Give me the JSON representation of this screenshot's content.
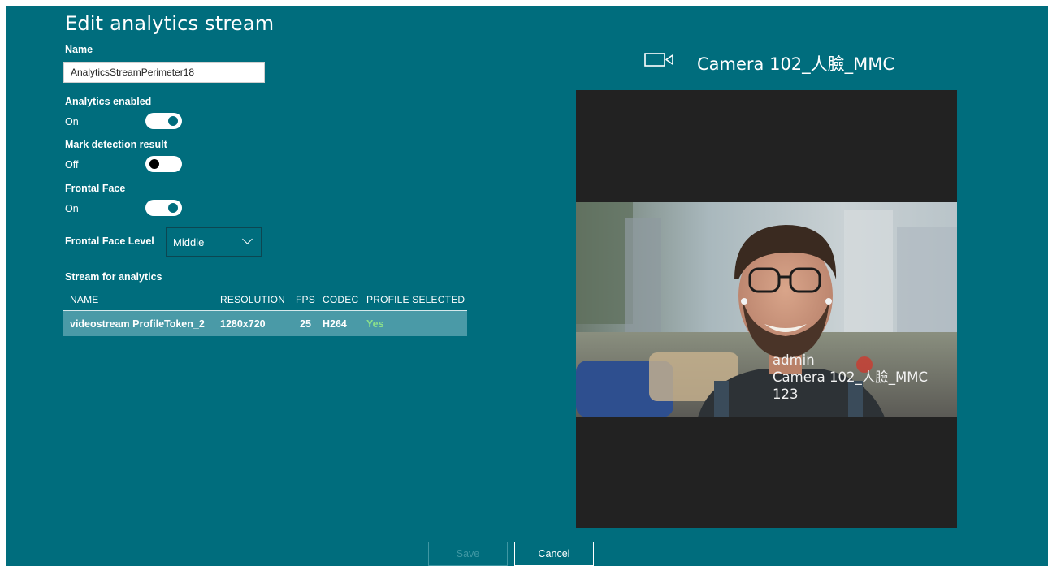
{
  "page": {
    "title": "Edit analytics stream"
  },
  "form": {
    "name_label": "Name",
    "name_value": "AnalyticsStreamPerimeter18",
    "analytics_enabled": {
      "label": "Analytics enabled",
      "state": "On",
      "on": true
    },
    "mark_detection": {
      "label": "Mark detection result",
      "state": "Off",
      "on": false
    },
    "frontal_face": {
      "label": "Frontal Face",
      "state": "On",
      "on": true
    },
    "frontal_face_level": {
      "label": "Frontal Face Level",
      "selected": "Middle"
    }
  },
  "stream": {
    "section_label": "Stream for analytics",
    "columns": [
      "NAME",
      "RESOLUTION",
      "FPS",
      "CODEC",
      "PROFILE SELECTED"
    ],
    "rows": [
      {
        "name": "videostream ProfileToken_2",
        "resolution": "1280x720",
        "fps": "25",
        "codec": "H264",
        "profile_selected": "Yes"
      }
    ]
  },
  "camera": {
    "icon": "video-camera-icon",
    "title": "Camera 102_人臉_MMC",
    "overlay_lines": [
      "admin",
      "Camera 102_人臉_MMC",
      "123"
    ]
  },
  "footer": {
    "save_label": "Save",
    "cancel_label": "Cancel"
  },
  "colors": {
    "background": "#006d7d",
    "selected_row": "#4a9aa7",
    "yes_text": "#8be08b",
    "video_bg": "#222222"
  }
}
